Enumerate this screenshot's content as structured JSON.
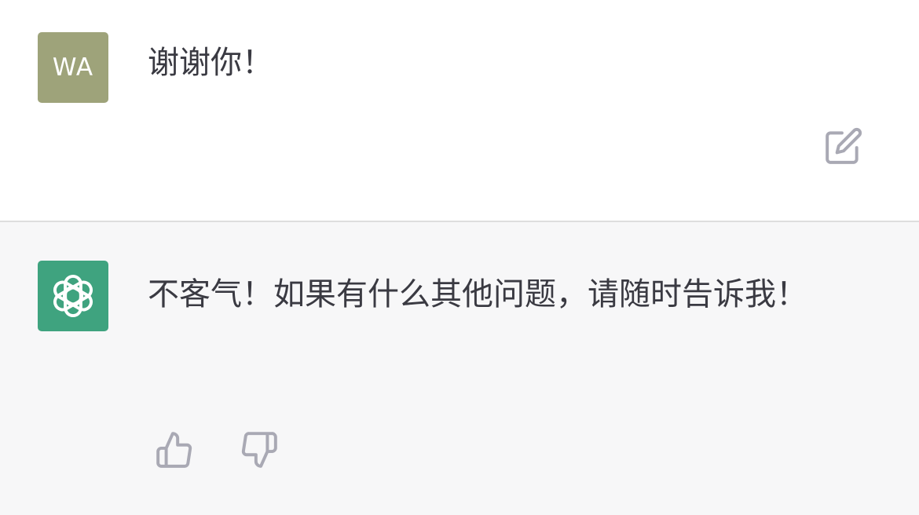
{
  "user": {
    "avatar_initials": "WA",
    "message": "谢谢你！",
    "avatar_color": "#9ea37a"
  },
  "assistant": {
    "avatar_icon": "openai-logo-icon",
    "message": "不客气！如果有什么其他问题，请随时告诉我！",
    "avatar_color": "#3fa37f"
  },
  "actions": {
    "edit_icon": "edit-icon",
    "thumbs_up_icon": "thumbs-up-icon",
    "thumbs_down_icon": "thumbs-down-icon"
  }
}
